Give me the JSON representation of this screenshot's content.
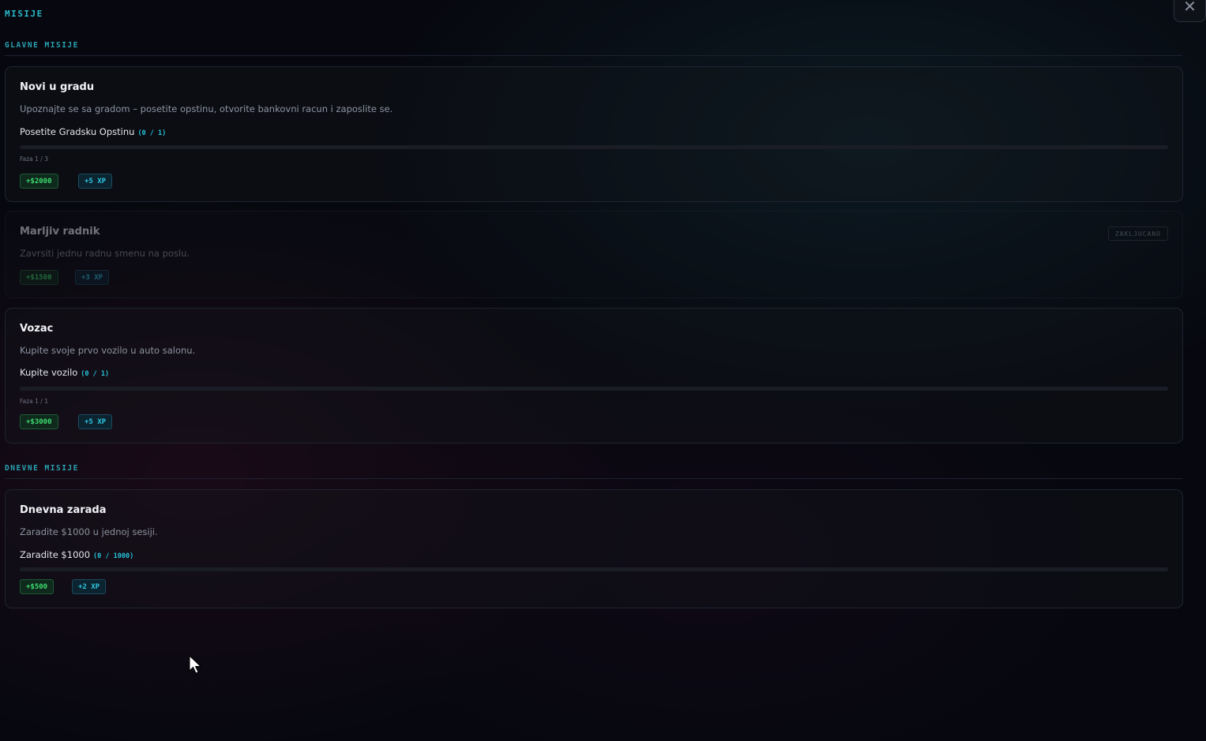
{
  "page": {
    "title": "MISIJE"
  },
  "close": {
    "label": "✕"
  },
  "sections": {
    "main": {
      "title": "GLAVNE MISIJE"
    },
    "daily": {
      "title": "DNEVNE MISIJE"
    }
  },
  "missions": {
    "m1": {
      "title": "Novi u gradu",
      "description": "Upoznajte se sa gradom – posetite opstinu, otvorite bankovni racun i zaposlite se.",
      "objective": "Posetite Gradsku Opstinu",
      "count": "(0 / 1)",
      "progress": 0,
      "phase": "Faza 1 / 3",
      "reward_money": "+$2000",
      "reward_xp": "+5 XP"
    },
    "m2": {
      "title": "Marljiv radnik",
      "description": "Zavrsiti jednu radnu smenu na poslu.",
      "locked_label": "ZAKLJUCANO",
      "reward_money": "+$1500",
      "reward_xp": "+3 XP"
    },
    "m3": {
      "title": "Vozac",
      "description": "Kupite svoje prvo vozilo u auto salonu.",
      "objective": "Kupite vozilo",
      "count": "(0 / 1)",
      "progress": 0,
      "phase": "Faza 1 / 1",
      "reward_money": "+$3000",
      "reward_xp": "+5 XP"
    },
    "m4": {
      "title": "Dnevna zarada",
      "description": "Zaradite $1000 u jednoj sesiji.",
      "objective": "Zaradite $1000",
      "count": "(0 / 1000)",
      "progress": 0,
      "reward_money": "+$500",
      "reward_xp": "+2 XP"
    }
  }
}
